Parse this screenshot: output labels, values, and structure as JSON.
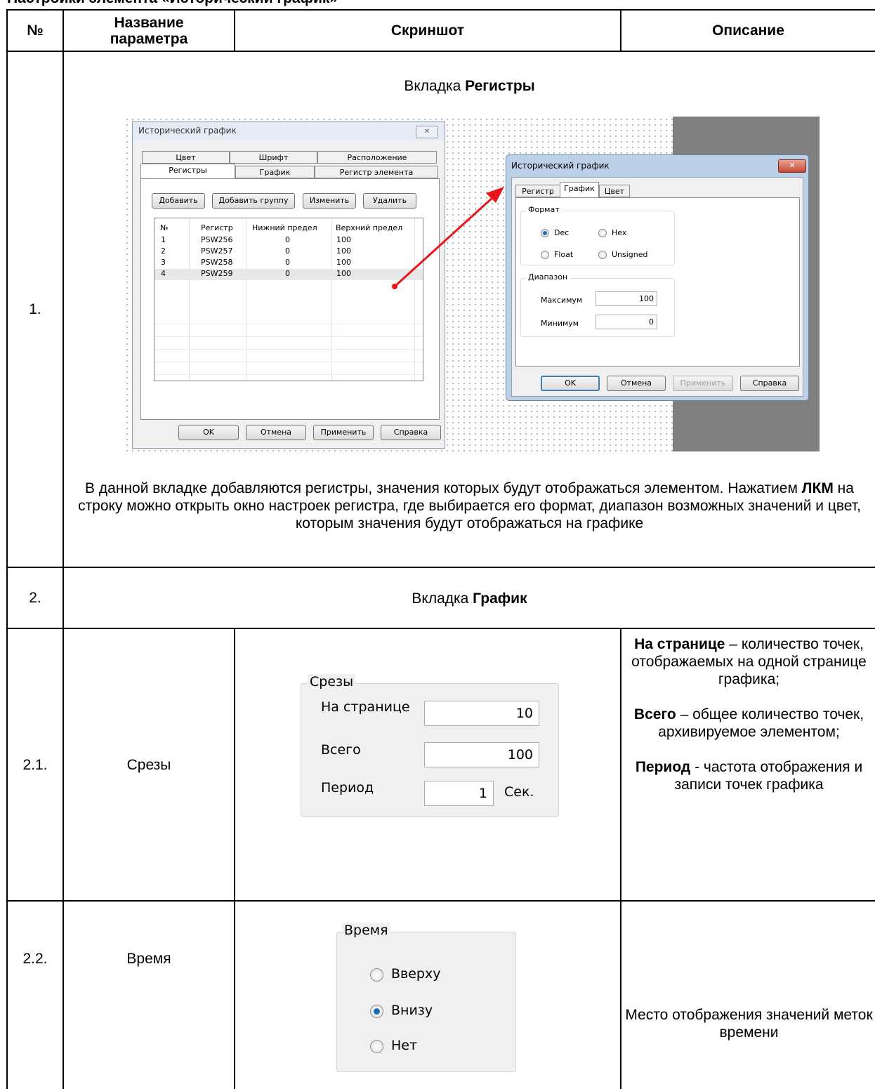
{
  "doc": {
    "top_cut_text": "Настройки элемента «Исторический график»",
    "headers": {
      "num": "№",
      "name": "Название параметра",
      "screenshot": "Скриншот",
      "desc": "Описание"
    },
    "row1": {
      "num": "1.",
      "title_plain": "Вкладка ",
      "title_bold": "Регистры",
      "desc_p1": "В данной вкладке добавляются регистры, значения которых будут отображаться элементом. Нажатием ",
      "desc_bold": "ЛКМ",
      "desc_p2": " на строку можно открыть окно настроек регистра, где выбирается его формат, диапазон возможных значений и цвет, которым значения будут отображаться на графике"
    },
    "row2": {
      "num": "2.",
      "title_plain": "Вкладка ",
      "title_bold": "График"
    },
    "row21": {
      "num": "2.1.",
      "name": "Срезы",
      "d1_bold": "На странице",
      "d1_text": " – количество точек, отображаемых на одной странице графика;",
      "d2_bold": "Всего",
      "d2_text": " – общее количество точек, архивируемое элементом;",
      "d3_bold": "Период",
      "d3_text": " - частота отображения и записи точек графика"
    },
    "row22": {
      "num": "2.2.",
      "name": "Время",
      "desc": "Место отображения значений меток времени"
    }
  },
  "dialog1": {
    "title": "Исторический график",
    "tabs_back": [
      "Цвет",
      "Шрифт",
      "Расположение"
    ],
    "tabs_front": [
      "Регистры",
      "График",
      "Регистр элемента"
    ],
    "buttons": [
      "Добавить",
      "Добавить группу",
      "Изменить",
      "Удалить"
    ],
    "columns": [
      "№",
      "Регистр",
      "Нижний предел",
      "Верхний предел"
    ],
    "rows": [
      [
        "1",
        "PSW256",
        "0",
        "100"
      ],
      [
        "2",
        "PSW257",
        "0",
        "100"
      ],
      [
        "3",
        "PSW258",
        "0",
        "100"
      ],
      [
        "4",
        "PSW259",
        "0",
        "100"
      ]
    ],
    "footer": [
      "OK",
      "Отмена",
      "Применить",
      "Справка"
    ]
  },
  "dialog2": {
    "title": "Исторический график",
    "tabs": [
      "Регистр",
      "График",
      "Цвет"
    ],
    "format_label": "Формат",
    "formats": [
      "Dec",
      "Hex",
      "Float",
      "Unsigned"
    ],
    "selected_format": "Dec",
    "range_label": "Диапазон",
    "max_label": "Максимум",
    "max_value": "100",
    "min_label": "Минимум",
    "min_value": "0",
    "footer": [
      "OK",
      "Отмена",
      "Применить",
      "Справка"
    ]
  },
  "slices": {
    "label": "Срезы",
    "per_page_label": "На странице",
    "per_page": "10",
    "total_label": "Всего",
    "total": "100",
    "period_label": "Период",
    "period": "1",
    "period_unit": "Сек."
  },
  "time": {
    "label": "Время",
    "options": [
      "Вверху",
      "Внизу",
      "Нет"
    ],
    "selected": "Внизу"
  },
  "colors": {
    "arrow": "#e8151b",
    "gray_panel": "#808080",
    "selected_radio": "#1e6db3"
  }
}
